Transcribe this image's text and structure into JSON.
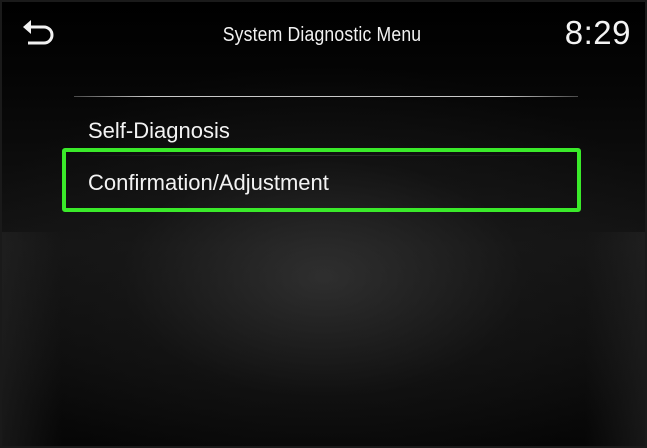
{
  "header": {
    "back_icon": "back-arrow-icon",
    "title": "System Diagnostic Menu",
    "clock": "8:29"
  },
  "menu": {
    "items": [
      {
        "label": "Self-Diagnosis",
        "selected": false
      },
      {
        "label": "Confirmation/Adjustment",
        "selected": true
      }
    ]
  },
  "colors": {
    "background": "#000000",
    "text": "#f2f2f2",
    "highlight": "#3aea2a",
    "divider": "#c9c9c9",
    "frame": "#1a1a1a"
  }
}
